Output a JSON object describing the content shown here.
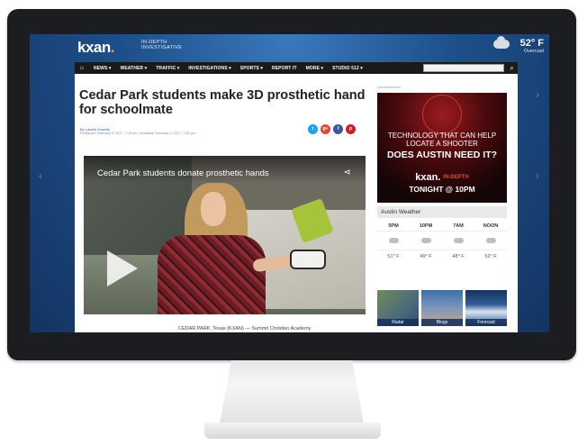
{
  "header": {
    "logo_text": "kxan",
    "logo_dot": ".",
    "tagline": "IN-DEPTH INVESTIGATIVE",
    "weather_temp": "52° F",
    "weather_condition": "Overcast",
    "weather_icon": "cloud-icon"
  },
  "nav": {
    "home_icon": "⌂",
    "items": [
      "NEWS ▾",
      "WEATHER ▾",
      "TRAFFIC ▾",
      "INVESTIGATIONS ▾",
      "SPORTS ▾",
      "REPORT IT",
      "MORE ▾",
      "STUDIO 512 ▾"
    ],
    "search_icon": "⌕"
  },
  "article": {
    "headline": "Cedar Park students make 3D prosthetic hand for schoolmate",
    "byline_prefix": "By ",
    "author": "Lauren Kravets",
    "dates": "Published: February 2, 2017, 7:13 pm  |  Updated: February 2, 2017, 7:28 pm",
    "share_buttons": [
      {
        "icon": "twitter-icon",
        "glyph": "t",
        "color": "#1da1f2"
      },
      {
        "icon": "google-plus-icon",
        "glyph": "g+",
        "color": "#dd4b39"
      },
      {
        "icon": "facebook-icon",
        "glyph": "f",
        "color": "#3b5998"
      },
      {
        "icon": "pinterest-icon",
        "glyph": "p",
        "color": "#cb2027"
      }
    ],
    "video_title": "Cedar Park students donate prosthetic hands",
    "video_share_glyph": "⋖",
    "dateline": "CEDAR PARK, Texas (KXAN) — Summit Christian Academy"
  },
  "sidebar": {
    "ad_label": "Advertisement",
    "ad": {
      "line1": "TECHNOLOGY THAT CAN HELP LOCATE A SHOOTER",
      "line2": "DOES AUSTIN NEED IT?",
      "logo": "kxan.",
      "logo_sub": "IN-DEPTH",
      "line3": "TONIGHT @ 10PM"
    },
    "weather_title": "Austin Weather",
    "forecast": [
      {
        "time": "5PM",
        "temp": "51° F"
      },
      {
        "time": "10PM",
        "temp": "49° F"
      },
      {
        "time": "7AM",
        "temp": "48° F"
      },
      {
        "time": "NOON",
        "temp": "52° F"
      }
    ],
    "thumbs": [
      "Radar",
      "Blogs",
      "Forecast"
    ]
  }
}
